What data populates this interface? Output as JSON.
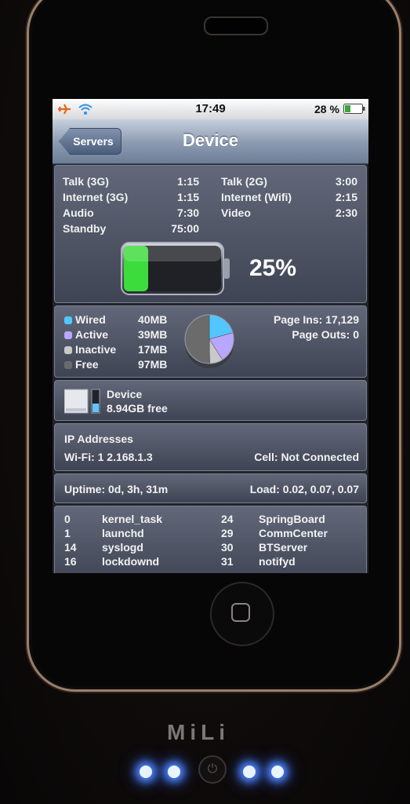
{
  "status_bar": {
    "time": "17:49",
    "battery": "28 %"
  },
  "nav": {
    "back_label": "Servers",
    "title": "Device"
  },
  "battery_panel": {
    "rows_left": [
      {
        "label": "Talk (3G)",
        "value": "1:15"
      },
      {
        "label": "Internet (3G)",
        "value": "1:15"
      },
      {
        "label": "Audio",
        "value": "7:30"
      },
      {
        "label": "Standby",
        "value": "75:00"
      }
    ],
    "rows_right": [
      {
        "label": "Talk (2G)",
        "value": "3:00"
      },
      {
        "label": "Internet (Wifi)",
        "value": "2:15"
      },
      {
        "label": "Video",
        "value": "2:30"
      }
    ],
    "level_percent": "25%",
    "level_fraction": 0.25,
    "fill_color": "#3bdc3b"
  },
  "memory_panel": {
    "items": [
      {
        "label": "Wired",
        "value": "40MB",
        "color": "#52c7ff"
      },
      {
        "label": "Active",
        "value": "39MB",
        "color": "#b9a6ff"
      },
      {
        "label": "Inactive",
        "value": "17MB",
        "color": "#c9c9c9"
      },
      {
        "label": "Free",
        "value": "97MB",
        "color": "#6b6b6b"
      }
    ],
    "page_ins": "Page Ins: 17,129",
    "page_outs": "Page Outs: 0"
  },
  "storage_panel": {
    "name": "Device",
    "free": "8.94GB free"
  },
  "ip_panel": {
    "heading": "IP Addresses",
    "wifi": "Wi-Fi: 1 2.168.1.3",
    "cell": "Cell: Not Connected"
  },
  "uptime_panel": {
    "uptime": "Uptime: 0d, 3h, 31m",
    "load": "Load: 0.02, 0.07, 0.07"
  },
  "process_panel": {
    "left": [
      {
        "pid": "0",
        "name": "kernel_task"
      },
      {
        "pid": "1",
        "name": "launchd"
      },
      {
        "pid": "14",
        "name": "syslogd"
      },
      {
        "pid": "16",
        "name": "lockdownd"
      }
    ],
    "right": [
      {
        "pid": "24",
        "name": "SpringBoard"
      },
      {
        "pid": "29",
        "name": "CommCenter"
      },
      {
        "pid": "30",
        "name": "BTServer"
      },
      {
        "pid": "31",
        "name": "notifyd"
      }
    ]
  },
  "case": {
    "brand": "MiLi"
  }
}
